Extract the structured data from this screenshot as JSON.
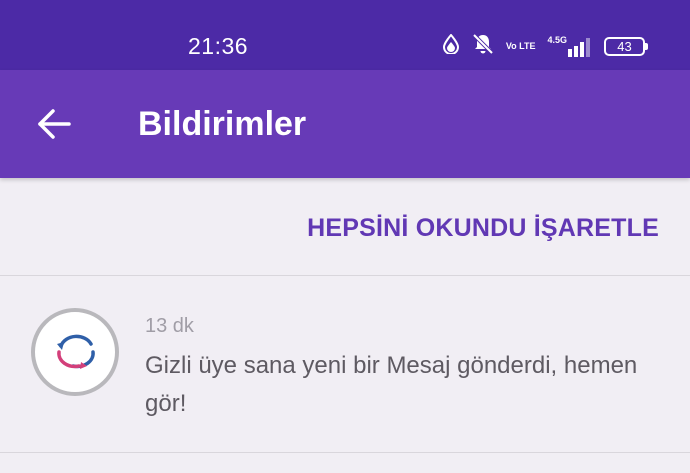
{
  "status_bar": {
    "time": "21:36",
    "volte_label": "Vo LTE",
    "network_label": "4.5G",
    "battery_level": "43",
    "icons": [
      "data-saver-icon",
      "notifications-off-icon",
      "volte-icon",
      "signal-icon",
      "battery-icon"
    ]
  },
  "app_bar": {
    "title": "Bildirimler",
    "back_icon": "arrow-left-icon",
    "background_color": "#673ab7"
  },
  "actions": {
    "mark_all_read_label": "HEPSİNİ OKUNDU İŞARETLE",
    "accent_color": "#6138b4"
  },
  "notifications": [
    {
      "time": "13 dk",
      "text": "Gizli üye sana yeni bir Mesaj gönderdi, hemen gör!",
      "avatar_icon": "app-logo-icon"
    }
  ]
}
